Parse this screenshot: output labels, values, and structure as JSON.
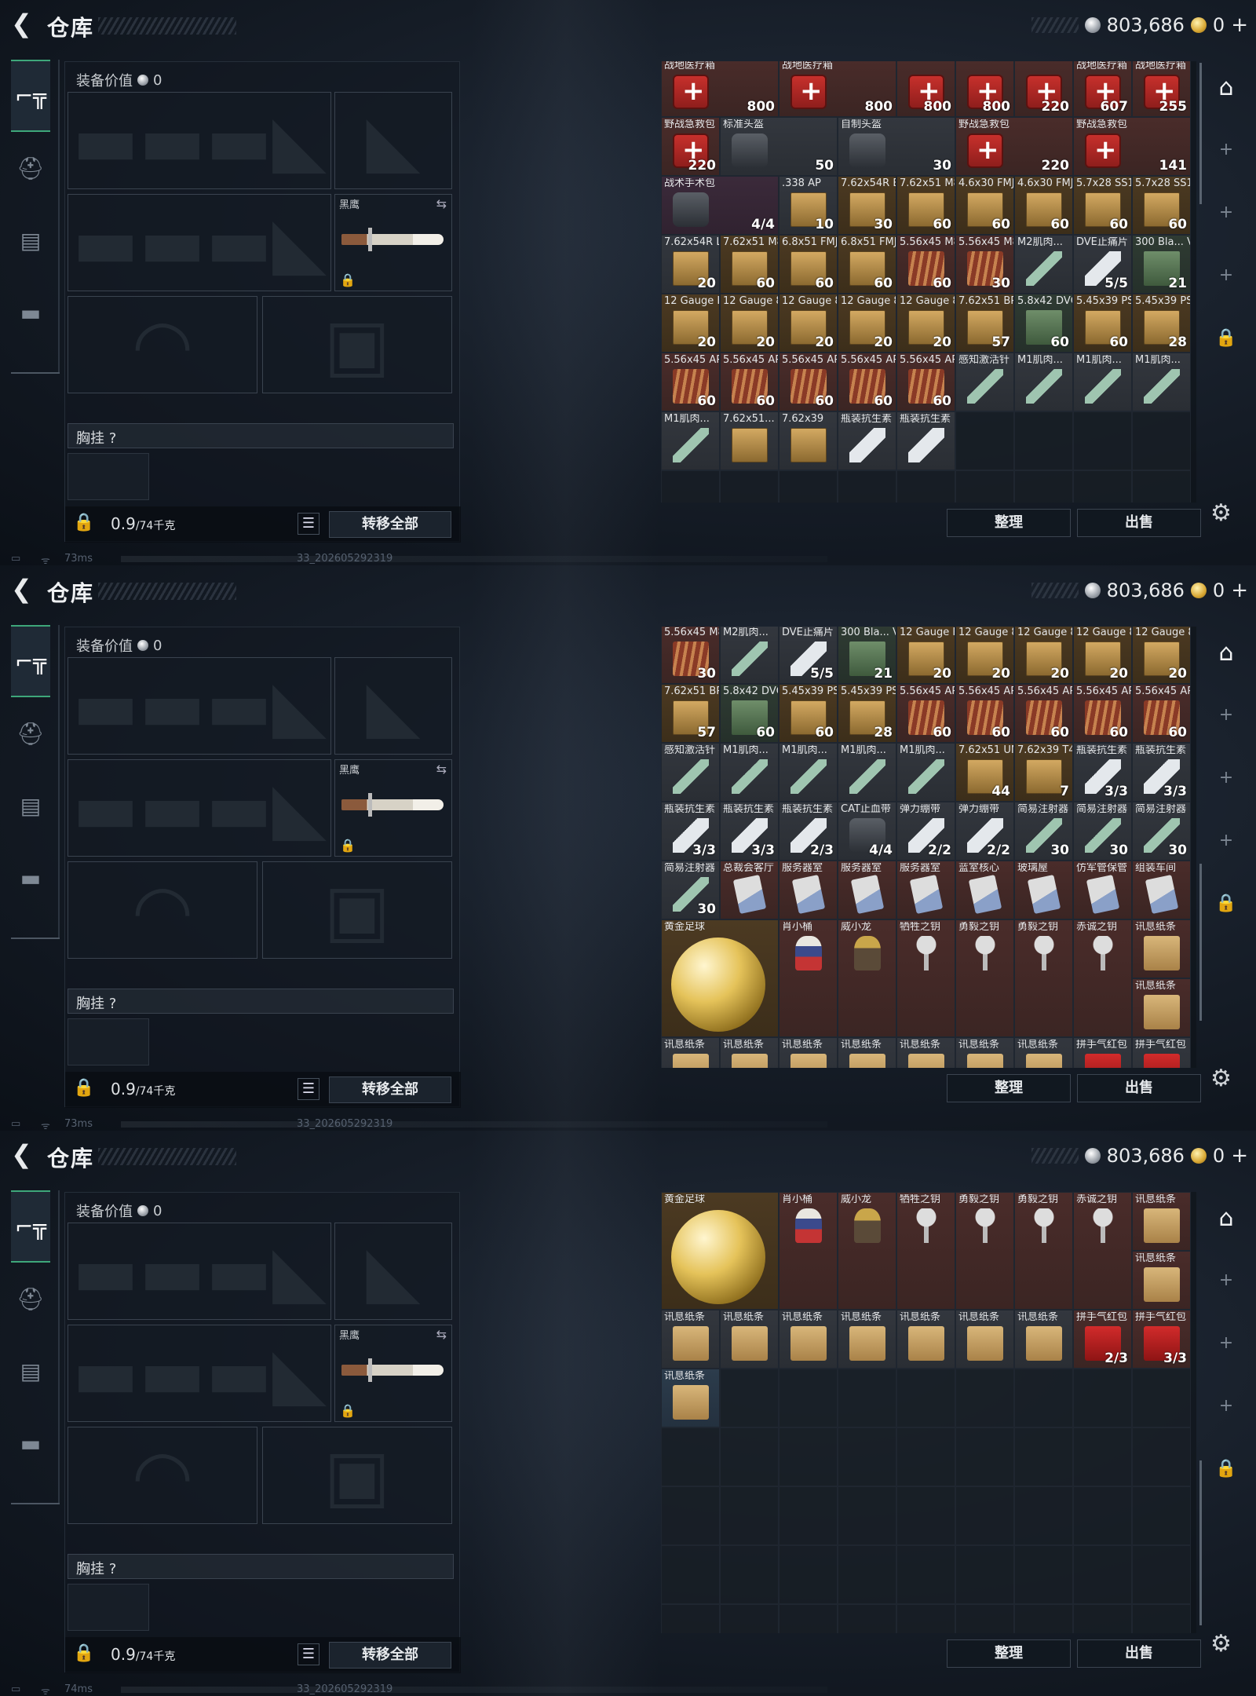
{
  "screens": [
    {
      "title": "仓库",
      "silver": "803,686",
      "gold": "0",
      "plus": "+",
      "equip_value_label": "装备价值",
      "equip_value": "0",
      "knife_name": "黑鹰",
      "chest_label": "胸挂",
      "chest_help": "?",
      "weight": "0.9",
      "weight_max": "/74千克",
      "transfer_all": "转移全部",
      "sort": "整理",
      "sell": "出售",
      "ping": "73ms",
      "build": "33_202605292319",
      "rows": [
        [
          [
            "战地医疗箱",
            "800",
            "red",
            "medkit",
            2
          ],
          [
            "战地医疗箱",
            "800",
            "red",
            "medkit",
            2
          ],
          [
            "",
            "800",
            "red",
            "medkit"
          ],
          [
            "",
            "800",
            "red",
            "medkit"
          ],
          [
            "",
            "220",
            "red",
            "medkit"
          ]
        ],
        [
          [
            "战地医疗箱",
            "607",
            "red",
            "medkit"
          ],
          [
            "战地医疗箱",
            "255",
            "red",
            "medkit"
          ],
          [
            "野战急救包",
            "220",
            "red",
            "medkit"
          ]
        ],
        [
          [
            "标准头盔",
            "50",
            "grey",
            "bag",
            2
          ],
          [
            "自制头盔",
            "30",
            "grey",
            "bag",
            2
          ]
        ],
        [
          [
            "野战急救包",
            "220",
            "red",
            "medkit",
            2
          ],
          [
            "野战急救包",
            "141",
            "red",
            "medkit",
            2
          ],
          [
            "战术手术包",
            "4/4",
            "purple",
            "bag",
            2
          ],
          [
            ".338 AP",
            "10",
            "grey",
            "box"
          ],
          [
            "7.62x54R B32",
            "30",
            "gold",
            "box"
          ],
          [
            "7.62x51 M80",
            "60",
            "gold",
            "box"
          ]
        ],
        [
          [
            "4.6x30 FMJ SX",
            "60",
            "gold",
            "box"
          ],
          [
            "4.6x30 FMJ SX",
            "60",
            "gold",
            "box"
          ],
          [
            "5.7x28 SS190",
            "60",
            "gold",
            "box"
          ],
          [
            "5.7x28 SS190",
            "60",
            "gold",
            "box"
          ],
          [
            "7.62x54R LPS",
            "20",
            "grey",
            "box"
          ],
          [
            "7.62x51 M80",
            "60",
            "gold",
            "box"
          ],
          [
            "6.8x51 FMJ",
            "60",
            "gold",
            "box"
          ],
          [
            "6.8x51 FMJ",
            "60",
            "gold",
            "box"
          ],
          [
            "5.56x45 M855A1",
            "60",
            "red",
            "shells"
          ]
        ],
        [
          [
            "5.56x45 M855A1",
            "30",
            "red",
            "shells"
          ],
          [
            "M2肌肉...",
            "",
            "grey",
            "inj"
          ],
          [
            "DVE止痛片",
            "5/5",
            "grey",
            "bottle"
          ],
          [
            "300 Bla... V-Max",
            "21",
            "green",
            "greenbox"
          ],
          [
            "12 Gauge FRAG",
            "20",
            "gold",
            "box"
          ],
          [
            "12 Gauge 8 Buck",
            "20",
            "gold",
            "box"
          ],
          [
            "12 Gauge 8 Buck",
            "20",
            "gold",
            "box"
          ],
          [
            "12 Gauge 8 Buck",
            "20",
            "gold",
            "box"
          ],
          [
            "12 Gauge 8 Buck",
            "20",
            "gold",
            "box"
          ]
        ],
        [
          [
            "7.62x51 BPZ",
            "57",
            "gold",
            "box"
          ],
          [
            "5.8x42 DVC12",
            "60",
            "green",
            "greenbox"
          ],
          [
            "5.45x39 PS",
            "60",
            "gold",
            "box"
          ],
          [
            "5.45x39 PS",
            "28",
            "gold",
            "box"
          ],
          [
            "5.56x45 APC",
            "60",
            "red",
            "shells"
          ],
          [
            "5.56x45 APC",
            "60",
            "red",
            "shells"
          ],
          [
            "5.56x45 APC",
            "60",
            "red",
            "shells"
          ],
          [
            "5.56x45 APC",
            "60",
            "red",
            "shells"
          ],
          [
            "5.56x45 APC",
            "60",
            "red",
            "shells"
          ]
        ],
        [
          [
            "感知激活针",
            "",
            "grey",
            "inj"
          ],
          [
            "M1肌肉...",
            "",
            "grey",
            "inj"
          ],
          [
            "M1肌肉...",
            "",
            "grey",
            "inj"
          ],
          [
            "M1肌肉...",
            "",
            "grey",
            "inj"
          ],
          [
            "M1肌肉...",
            "",
            "grey",
            "inj"
          ],
          [
            "7.62x51...",
            "",
            "grey",
            "box"
          ],
          [
            "7.62x39",
            "",
            "grey",
            "box"
          ],
          [
            "瓶装抗生素",
            "",
            "grey",
            "bottle"
          ],
          [
            "瓶装抗生素",
            "",
            "grey",
            "bottle"
          ]
        ]
      ]
    },
    {
      "title": "仓库",
      "silver": "803,686",
      "gold": "0",
      "plus": "+",
      "equip_value_label": "装备价值",
      "equip_value": "0",
      "knife_name": "黑鹰",
      "chest_label": "胸挂",
      "chest_help": "?",
      "weight": "0.9",
      "weight_max": "/74千克",
      "transfer_all": "转移全部",
      "sort": "整理",
      "sell": "出售",
      "ping": "73ms",
      "build": "33_202605292319",
      "rows": [
        [
          [
            "5.56x45 M855A1",
            "30",
            "red",
            "shells"
          ],
          [
            "M2肌肉...",
            "",
            "grey",
            "inj"
          ],
          [
            "DVE止痛片",
            "5/5",
            "grey",
            "bottle"
          ],
          [
            "300 Bla... V-Max",
            "21",
            "green",
            "greenbox"
          ],
          [
            "12 Gauge FRAG",
            "20",
            "gold",
            "box"
          ],
          [
            "12 Gauge 8 Buck",
            "20",
            "gold",
            "box"
          ],
          [
            "12 Gauge 8 Buck",
            "20",
            "gold",
            "box"
          ],
          [
            "12 Gauge 8 Buck",
            "20",
            "gold",
            "box"
          ],
          [
            "12 Gauge 8 Buck",
            "20",
            "gold",
            "box"
          ]
        ],
        [
          [
            "7.62x51 BPZ",
            "57",
            "gold",
            "box"
          ],
          [
            "5.8x42 DVC12",
            "60",
            "green",
            "greenbox"
          ],
          [
            "5.45x39 PS",
            "60",
            "gold",
            "box"
          ],
          [
            "5.45x39 PS",
            "28",
            "gold",
            "box"
          ],
          [
            "5.56x45 APC",
            "60",
            "red",
            "shells"
          ],
          [
            "5.56x45 APC",
            "60",
            "red",
            "shells"
          ],
          [
            "5.56x45 APC",
            "60",
            "red",
            "shells"
          ],
          [
            "5.56x45 APC",
            "60",
            "red",
            "shells"
          ],
          [
            "5.56x45 APC",
            "60",
            "red",
            "shells"
          ]
        ],
        [
          [
            "感知激活针",
            "",
            "grey",
            "inj"
          ],
          [
            "M1肌肉...",
            "",
            "grey",
            "inj"
          ],
          [
            "M1肌肉...",
            "",
            "grey",
            "inj"
          ],
          [
            "M1肌肉...",
            "",
            "grey",
            "inj"
          ],
          [
            "M1肌肉...",
            "",
            "grey",
            "inj"
          ],
          [
            "7.62x51 UMAK",
            "44",
            "gold",
            "box"
          ],
          [
            "7.62x39 T45M",
            "7",
            "gold",
            "box"
          ],
          [
            "瓶装抗生素",
            "3/3",
            "grey",
            "bottle"
          ],
          [
            "瓶装抗生素",
            "3/3",
            "grey",
            "bottle"
          ]
        ],
        [
          [
            "瓶装抗生素",
            "3/3",
            "grey",
            "bottle"
          ],
          [
            "瓶装抗生素",
            "3/3",
            "grey",
            "bottle"
          ],
          [
            "瓶装抗生素",
            "2/3",
            "grey",
            "bottle"
          ],
          [
            "CAT止血带",
            "4/4",
            "grey",
            "bag"
          ],
          [
            "弹力绷带",
            "2/2",
            "grey",
            "bottle"
          ],
          [
            "弹力绷带",
            "2/2",
            "grey",
            "bottle"
          ],
          [
            "简易注射器",
            "30",
            "grey",
            "inj"
          ],
          [
            "简易注射器",
            "30",
            "grey",
            "inj"
          ],
          [
            "简易注射器",
            "30",
            "grey",
            "inj"
          ]
        ],
        [
          [
            "简易注射器",
            "30",
            "grey",
            "inj"
          ],
          [
            "总裁会客厅",
            "",
            "red",
            "card"
          ],
          [
            "服务器室",
            "",
            "red",
            "card"
          ],
          [
            "服务器室",
            "",
            "red",
            "card"
          ],
          [
            "服务器室",
            "",
            "red",
            "card"
          ],
          [
            "蓝室核心",
            "",
            "red",
            "card"
          ],
          [
            "玻璃屋",
            "",
            "red",
            "card"
          ],
          [
            "仿军管保管",
            "",
            "red",
            "card"
          ],
          [
            "组装车间",
            "",
            "red",
            "card"
          ]
        ],
        [
          [
            "黄金足球",
            "",
            "gold",
            "ball",
            2,
            2
          ],
          [
            "肖小桶",
            "",
            "red",
            "fig",
            1,
            2
          ],
          [
            "威小龙",
            "",
            "red",
            "figg",
            1,
            2
          ],
          [
            "牺牲之钥",
            "",
            "red",
            "key",
            1,
            2
          ],
          [
            "勇毅之钥",
            "",
            "red",
            "key",
            1,
            2
          ],
          [
            "勇毅之钥",
            "",
            "red",
            "key",
            1,
            2
          ],
          [
            "赤诚之钥",
            "",
            "red",
            "key",
            1,
            2
          ],
          [
            "讯息纸条",
            "",
            "red",
            "paper"
          ]
        ],
        [
          [
            "讯息纸条",
            "",
            "red",
            "paper"
          ]
        ],
        [
          [
            "讯息纸条",
            "",
            "grey",
            "paper"
          ],
          [
            "讯息纸条",
            "",
            "grey",
            "paper"
          ],
          [
            "讯息纸条",
            "",
            "grey",
            "paper"
          ],
          [
            "讯息纸条",
            "",
            "grey",
            "paper"
          ],
          [
            "讯息纸条",
            "",
            "grey",
            "paper"
          ],
          [
            "讯息纸条",
            "",
            "grey",
            "paper"
          ],
          [
            "讯息纸条",
            "",
            "grey",
            "paper"
          ],
          [
            "拼手气红包",
            "",
            "grey",
            "redenv"
          ],
          [
            "拼手气红包",
            "",
            "grey",
            "redenv"
          ]
        ]
      ]
    },
    {
      "title": "仓库",
      "silver": "803,686",
      "gold": "0",
      "plus": "+",
      "equip_value_label": "装备价值",
      "equip_value": "0",
      "knife_name": "黑鹰",
      "chest_label": "胸挂",
      "chest_help": "?",
      "weight": "0.9",
      "weight_max": "/74千克",
      "transfer_all": "转移全部",
      "sort": "整理",
      "sell": "出售",
      "ping": "74ms",
      "build": "33_202605292319",
      "rows": [
        [
          [
            "黄金足球",
            "",
            "gold",
            "ball",
            2,
            2
          ],
          [
            "肖小桶",
            "",
            "red",
            "fig",
            1,
            2
          ],
          [
            "威小龙",
            "",
            "red",
            "figg",
            1,
            2
          ],
          [
            "牺牲之钥",
            "",
            "red",
            "key",
            1,
            2
          ],
          [
            "勇毅之钥",
            "",
            "red",
            "key",
            1,
            2
          ],
          [
            "勇毅之钥",
            "",
            "red",
            "key",
            1,
            2
          ],
          [
            "赤诚之钥",
            "",
            "red",
            "key",
            1,
            2
          ],
          [
            "讯息纸条",
            "",
            "red",
            "paper"
          ]
        ],
        [
          [
            "讯息纸条",
            "",
            "red",
            "paper"
          ]
        ],
        [
          [
            "讯息纸条",
            "",
            "grey",
            "paper"
          ],
          [
            "讯息纸条",
            "",
            "grey",
            "paper"
          ],
          [
            "讯息纸条",
            "",
            "grey",
            "paper"
          ],
          [
            "讯息纸条",
            "",
            "grey",
            "paper"
          ],
          [
            "讯息纸条",
            "",
            "grey",
            "paper"
          ],
          [
            "讯息纸条",
            "",
            "grey",
            "paper"
          ],
          [
            "讯息纸条",
            "",
            "grey",
            "paper"
          ],
          [
            "拼手气红包",
            "2/3",
            "red",
            "redenv"
          ],
          [
            "拼手气红包",
            "3/3",
            "red",
            "redenv"
          ]
        ],
        [
          [
            "讯息纸条",
            "",
            "blue",
            "paper"
          ]
        ]
      ]
    }
  ]
}
